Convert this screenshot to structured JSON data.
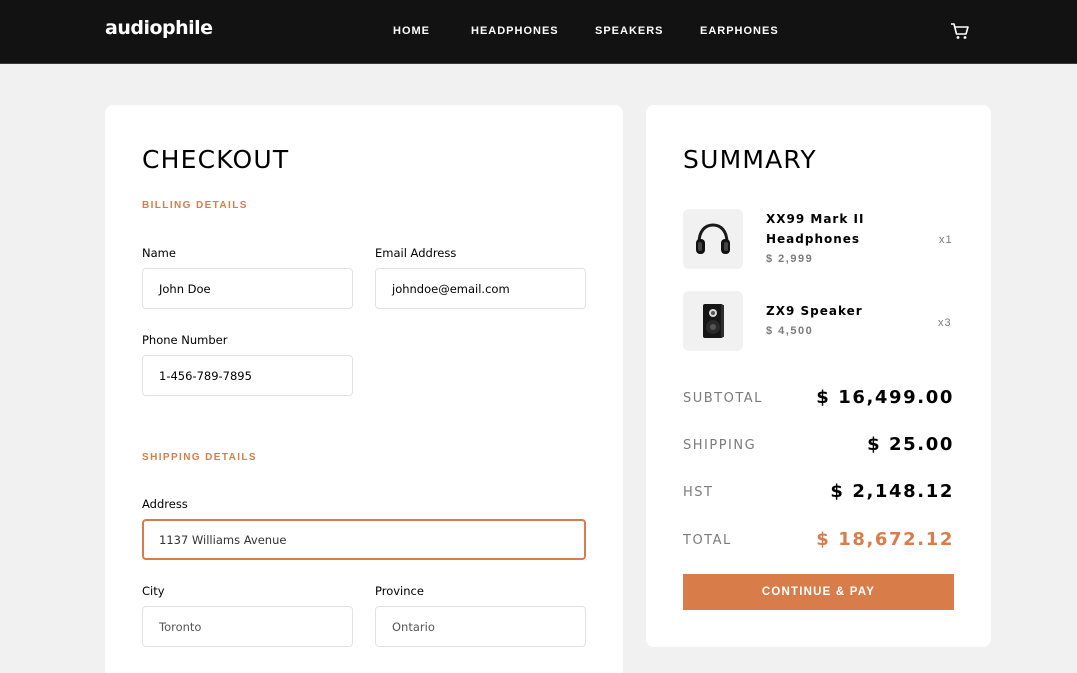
{
  "header": {
    "logo": "audiophile",
    "nav": [
      "HOME",
      "HEADPHONES",
      "SPEAKERS",
      "EARPHONES"
    ],
    "cart_icon": "cart-icon"
  },
  "checkout": {
    "title": "CHECKOUT",
    "billing": {
      "section_label": "BILLING DETAILS",
      "name_label": "Name",
      "name_value": "John Doe",
      "email_label": "Email Address",
      "email_value": "johndoe@email.com",
      "phone_label": "Phone Number",
      "phone_value": "1-456-789-7895"
    },
    "shipping": {
      "section_label": "SHIPPING DETAILS",
      "address_label": "Address",
      "address_value": "1137 Williams Avenue",
      "city_label": "City",
      "city_value": "Toronto",
      "province_label": "Province",
      "province_value": "Ontario"
    }
  },
  "summary": {
    "title": "SUMMARY",
    "items": [
      {
        "name_line1": "XX99 Mark II",
        "name_line2": "Headphones",
        "price": "$ 2,999",
        "qty": "x1",
        "icon": "headphones-icon"
      },
      {
        "name_line1": "ZX9 Speaker",
        "price": "$ 4,500",
        "qty": "x3",
        "icon": "speaker-icon"
      }
    ],
    "subtotal_label": "SUBTOTAL",
    "subtotal_value": "$ 16,499.00",
    "shipping_label": "SHIPPING",
    "shipping_value": "$ 25.00",
    "hst_label": "HST",
    "hst_value": "$ 2,148.12",
    "total_label": "TOTAL",
    "total_value": "$ 18,672.12",
    "pay_button": "CONTINUE & PAY"
  },
  "colors": {
    "accent": "#d87d4a",
    "header_bg": "#121212",
    "page_bg": "#f1f1f1"
  }
}
